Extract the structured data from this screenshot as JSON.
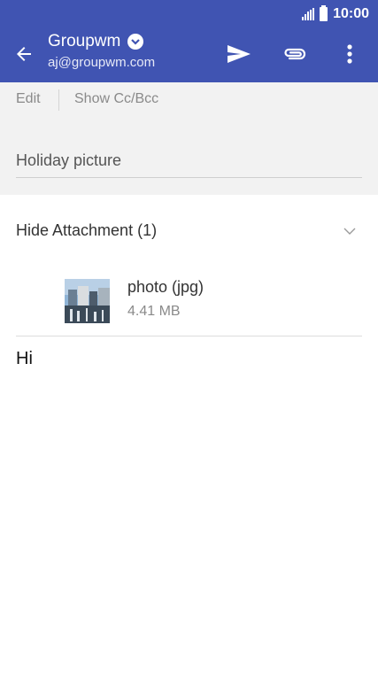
{
  "status_bar": {
    "time": "10:00",
    "signal_icon": "signal-icon",
    "battery_icon": "battery-icon"
  },
  "app_bar": {
    "account_name": "Groupwm",
    "account_email": "aj@groupwm.com",
    "background_color": "#4054b2",
    "icons": {
      "back": "arrow-left-icon",
      "dropdown": "chevron-down-circle-icon",
      "send": "send-icon",
      "attach": "paperclip-icon",
      "more": "more-vertical-icon"
    }
  },
  "compose_toolbar": {
    "edit_label": "Edit",
    "show_cc_bcc_label": "Show Cc/Bcc"
  },
  "subject": {
    "value": "Holiday picture"
  },
  "attachments": {
    "header": "Hide Attachment (1)",
    "items": [
      {
        "name": "photo (jpg)",
        "size": "4.41 MB"
      }
    ]
  },
  "message_body": {
    "text": "Hi"
  }
}
